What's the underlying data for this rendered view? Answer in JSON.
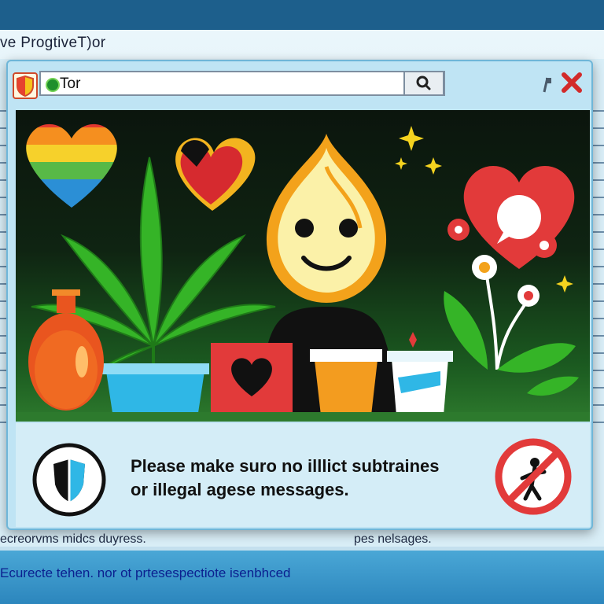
{
  "background": {
    "window_title": "ve ProgtiveT)or",
    "text_left": "ecreorvms midcs duyress.",
    "text_right": "pes nelsages.",
    "footer_text": "Ecurecte tehen. nor ot prtesespectiote isenbhced"
  },
  "dialog": {
    "address_text": "Tor",
    "search_icon": "search-icon",
    "pin_icon": "pin-icon",
    "close_icon": "close-icon",
    "app_icon": "browser-shield-icon"
  },
  "banner": {
    "illustration": "tor-onion-mascot-with-hearts-leaf-flowers"
  },
  "message": {
    "line1": "Please make suro no illlict subtraines",
    "line2": "or illegal agese messages.",
    "left_icon": "shield-icon",
    "right_icon": "prohibited-icon"
  },
  "colors": {
    "accent_red": "#e23a3a",
    "tor_green": "#1f8f2c",
    "onion_orange": "#f3a21b"
  }
}
